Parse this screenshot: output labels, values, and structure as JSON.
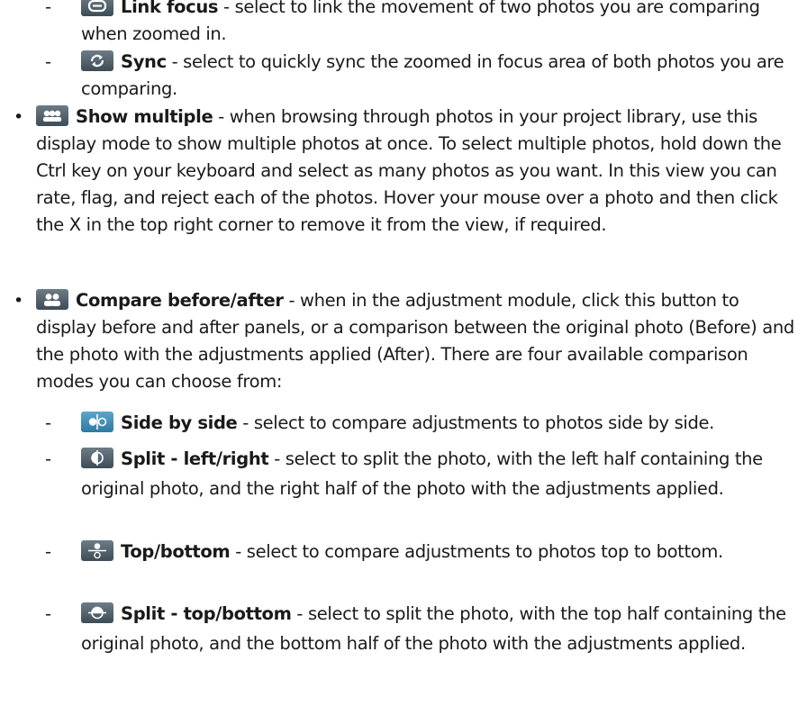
{
  "items": [
    {
      "type": "sub",
      "icon": "link-focus-icon",
      "label": "Link focus",
      "text": " - select to link the movement of two photos you are comparing when zoomed in."
    },
    {
      "type": "sub",
      "icon": "sync-icon",
      "label": "Sync",
      "text": " - select to quickly sync the zoomed in focus area of both photos you are comparing."
    },
    {
      "type": "bullet",
      "icon": "show-multiple-icon",
      "label": "Show multiple",
      "text": " - when browsing through photos in your project library, use this display mode to show multiple photos at once. To select multiple photos, hold down the Ctrl key on your keyboard and select as many photos as you want. In this view you can rate, flag, and reject each of the photos. Hover your mouse over a photo and then click the X in the top right corner to remove it from the view, if required."
    },
    {
      "type": "bullet",
      "icon": "compare-before-after-icon",
      "label": "Compare before/after",
      "text": " - when in the adjustment module, click this button to display before and after panels, or a comparison between the original photo (Before) and the photo with the adjustments applied (After). There are four available comparison modes you can choose from:"
    },
    {
      "type": "sub",
      "icon": "side-by-side-icon",
      "label": "Side by side",
      "text": " - select to compare adjustments to photos side by side."
    },
    {
      "type": "sub",
      "icon": "split-left-right-icon",
      "label": "Split - left/right",
      "text": " - select to split the photo, with the left half containing the original photo, and the right half of the photo with the adjustments applied."
    },
    {
      "type": "sub",
      "icon": "top-bottom-icon",
      "label": "Top/bottom",
      "text": " - select to compare adjustments to photos top to bottom."
    },
    {
      "type": "sub",
      "icon": "split-top-bottom-icon",
      "label": "Split - top/bottom",
      "text": " - select to split the photo, with the top half containing the original photo, and the bottom half of the photo with the adjustments applied."
    }
  ],
  "bullet_symbol": "•",
  "dash_symbol": "-"
}
